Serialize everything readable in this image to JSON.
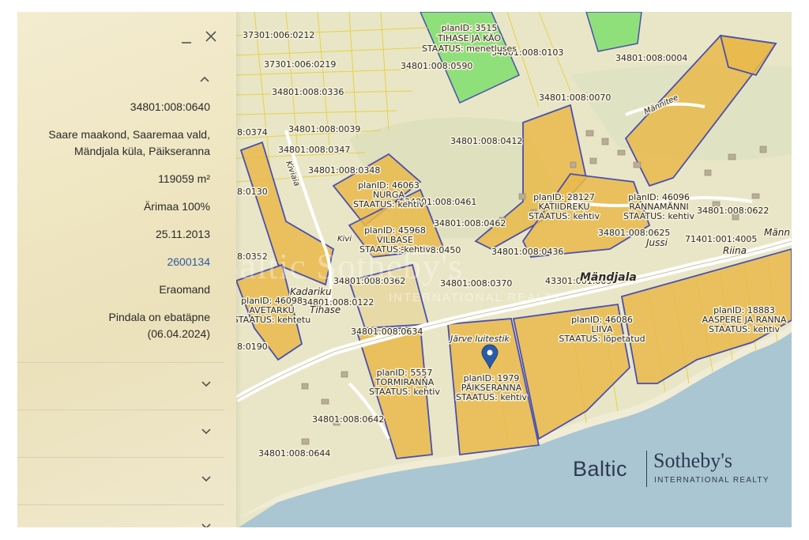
{
  "panel": {
    "minimize_icon": "minus-icon",
    "close_icon": "close-icon",
    "collapse_icon": "chevron-up-icon",
    "expand_icon": "chevron-down-icon",
    "cadastral_code": "34801:008:0640",
    "address_line1": "Saare maakond, Saaremaa vald,",
    "address_line2": "Mändjala küla, Päikseranna",
    "area": "119059 m²",
    "purpose": "Ärimaa 100%",
    "date": "25.11.2013",
    "link_number": "2600134",
    "ownership": "Eraomand",
    "note_line1": "Pindala on ebatäpne",
    "note_line2": "(06.04.2024)"
  },
  "map": {
    "parcel_labels": [
      "37301:006:0212",
      "37301:006:0219",
      "34801:008:0336",
      "34801:008:0039",
      "34801:008:0347",
      "34801:008:0348",
      "34801:008:0590",
      "34801:008:0103",
      "34801:008:0004",
      "34801:008:0070",
      "34801:008:0412",
      "34801:008:0461",
      "34801:008:0462",
      "34801:008:0450",
      "34801:008:0436",
      "34801:008:0370",
      "34801:008:0362",
      "34801:008:0122",
      "34801:008:0634",
      "34801:008:0642",
      "34801:008:0644",
      "34801:008:0625",
      "34801:008:0622",
      "71401:001:4005",
      "43301:001:0098",
      "8:0374",
      "8:0130",
      "8:0352",
      "8:0190",
      "34801:008:0640"
    ],
    "plan_labels": [
      {
        "id": "planID: 3515",
        "name": "TIHASE JA KÄO",
        "status": "STAATUS: menetluses"
      },
      {
        "id": "planID: 46063",
        "name": "NURGA",
        "status": "STAATUS: kehtiv"
      },
      {
        "id": "planID: 45968",
        "name": "VILBASE",
        "status": "STAATUS: kehtiv"
      },
      {
        "id": "planID: 28127",
        "name": "KATIIDREKU",
        "status": "STAATUS: kehtiv"
      },
      {
        "id": "planID: 46096",
        "name": "RANNAMÄNNI",
        "status": "STAATUS: kehtiv"
      },
      {
        "id": "planID: 46098",
        "name": "AVETARKU",
        "status": "STAATUS: kehtetu"
      },
      {
        "id": "planID: 5557",
        "name": "TORMIRANNA",
        "status": "STAATUS: kehtiv"
      },
      {
        "id": "planID: 1979",
        "name": "PÄIKSERANNA",
        "status": "STAATUS: kehtiv"
      },
      {
        "id": "planID: 46086",
        "name": "LIIVA",
        "status": "STAATUS: lõpetatud"
      },
      {
        "id": "planID: 18883",
        "name": "AASPERE JA RANNA",
        "status": "STAATUS: kehtiv"
      }
    ],
    "place_labels": [
      "Mändjala",
      "Jussi",
      "Riina",
      "Männ",
      "Kadariku",
      "Tihase",
      "Järve luitestik",
      "Kiviaia",
      "Männitee",
      "Kivi"
    ],
    "marker_icon": "map-pin-icon"
  },
  "logo": {
    "brand": "Baltic",
    "name": "Sotheby's",
    "tagline": "INTERNATIONAL REALTY",
    "watermark": "Baltic Sotheby's",
    "watermark_sub": "INTERNATIONAL REALTY"
  },
  "colors": {
    "parcel_fill": "#e9b84a",
    "parcel_border": "#4a4fb0",
    "green_plan": "#8fe07a",
    "sea": "#aac7d3",
    "land": "#e9e4c4",
    "link": "#2c5aa0"
  }
}
